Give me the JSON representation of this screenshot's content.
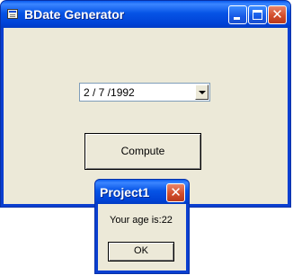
{
  "window": {
    "title": "BDate Generator",
    "icon": "form-window-icon",
    "controls": {
      "minimize": "minimize-icon",
      "maximize": "maximize-icon",
      "close": "close-icon"
    }
  },
  "form": {
    "date_value": "2 / 7 /1992",
    "compute_label": "Compute"
  },
  "dialog": {
    "title": "Project1",
    "message": "Your age is:22",
    "ok_label": "OK",
    "close_glyph": "✕"
  },
  "colors": {
    "titlebar": "#0054e3",
    "client": "#ece9d8",
    "close_button": "#d34e2c"
  }
}
